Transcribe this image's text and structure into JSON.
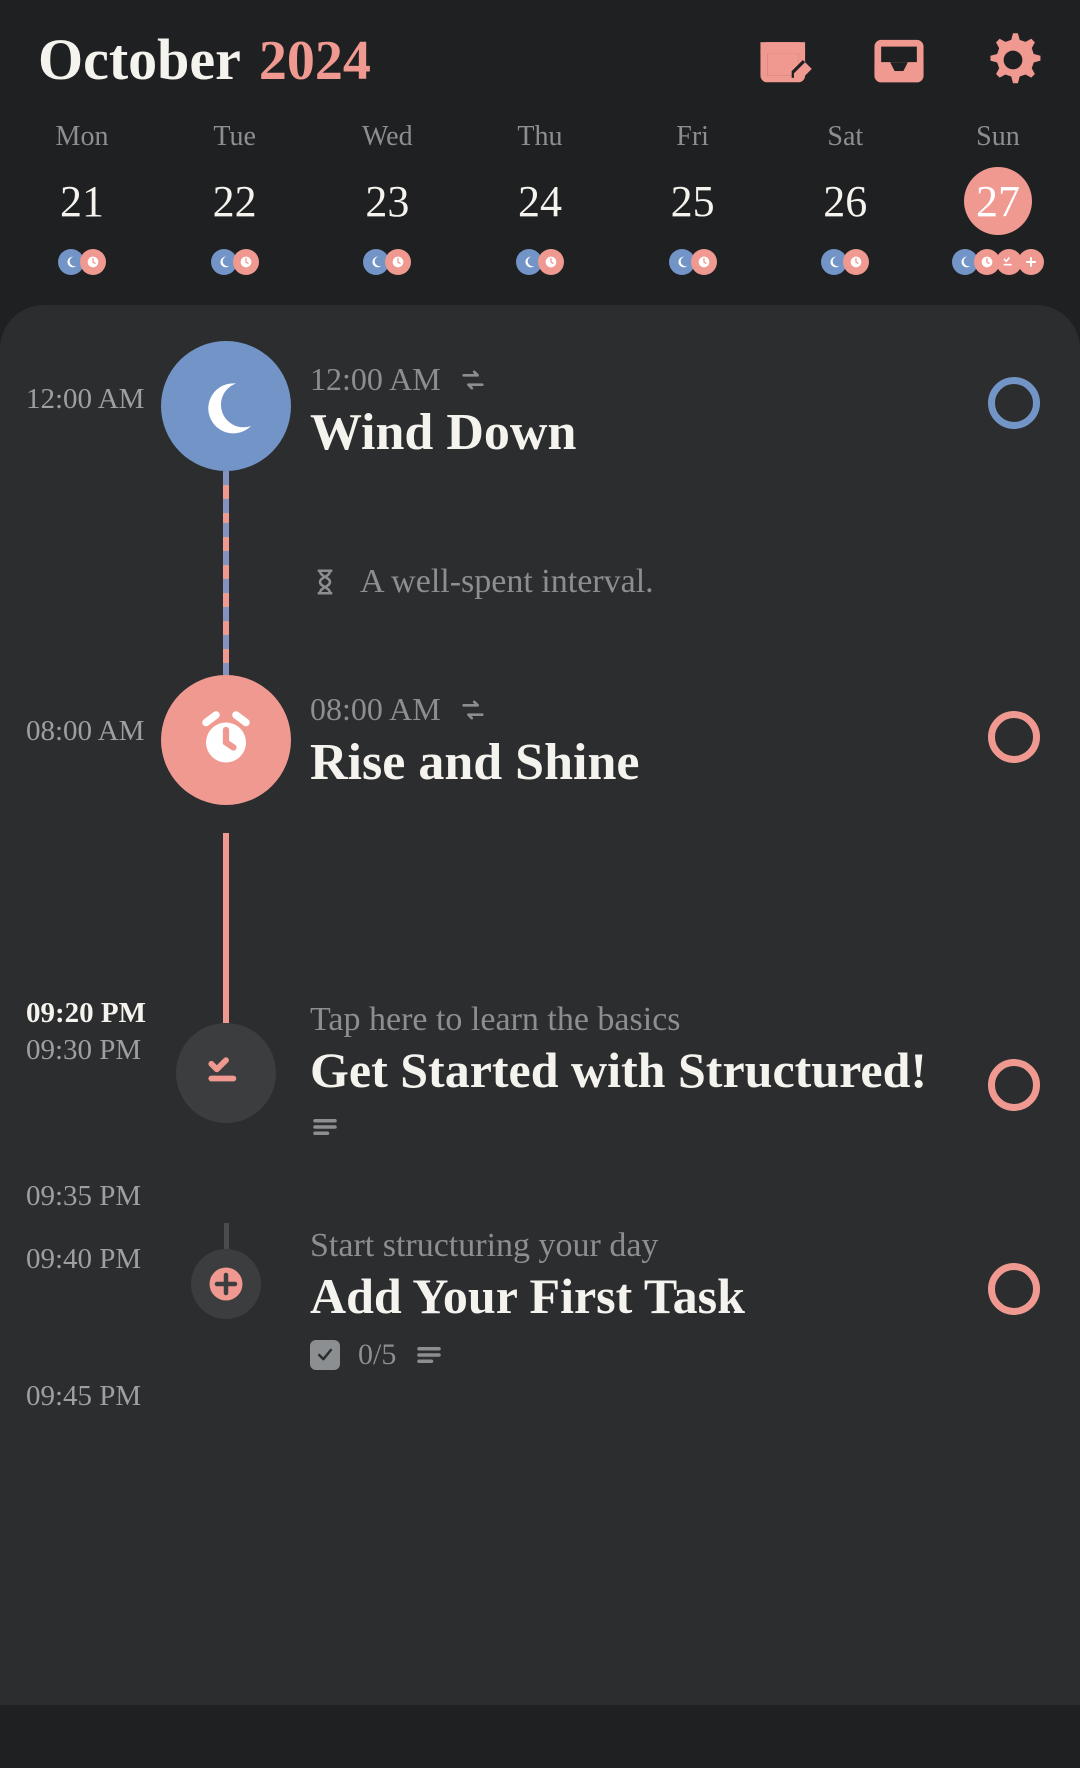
{
  "header": {
    "month": "October",
    "year": "2024"
  },
  "week": [
    {
      "dow": "Mon",
      "num": "21",
      "selected": false,
      "dots": [
        "moon",
        "clock"
      ]
    },
    {
      "dow": "Tue",
      "num": "22",
      "selected": false,
      "dots": [
        "moon",
        "clock"
      ]
    },
    {
      "dow": "Wed",
      "num": "23",
      "selected": false,
      "dots": [
        "moon",
        "clock"
      ]
    },
    {
      "dow": "Thu",
      "num": "24",
      "selected": false,
      "dots": [
        "moon",
        "clock"
      ]
    },
    {
      "dow": "Fri",
      "num": "25",
      "selected": false,
      "dots": [
        "moon",
        "clock"
      ]
    },
    {
      "dow": "Sat",
      "num": "26",
      "selected": false,
      "dots": [
        "moon",
        "clock"
      ]
    },
    {
      "dow": "Sun",
      "num": "27",
      "selected": true,
      "dots": [
        "moon",
        "clock",
        "checklist",
        "plus"
      ]
    }
  ],
  "timeline": {
    "wind": {
      "timecol": "12:00 AM",
      "meta_time": "12:00 AM",
      "title": "Wind Down"
    },
    "interval": "A well-spent interval.",
    "rise": {
      "timecol": "08:00 AM",
      "meta_time": "08:00 AM",
      "title": "Rise and Shine"
    },
    "nowrow": {
      "now": "09:20 PM",
      "start": "09:30 PM",
      "end": "09:35 PM",
      "subtitle": "Tap here to learn the basics",
      "title": "Get Started with Structured!"
    },
    "addrow": {
      "start": "09:40 PM",
      "end": "09:45 PM",
      "subtitle": "Start structuring your day",
      "title": "Add Your First Task",
      "progress": "0/5"
    }
  }
}
